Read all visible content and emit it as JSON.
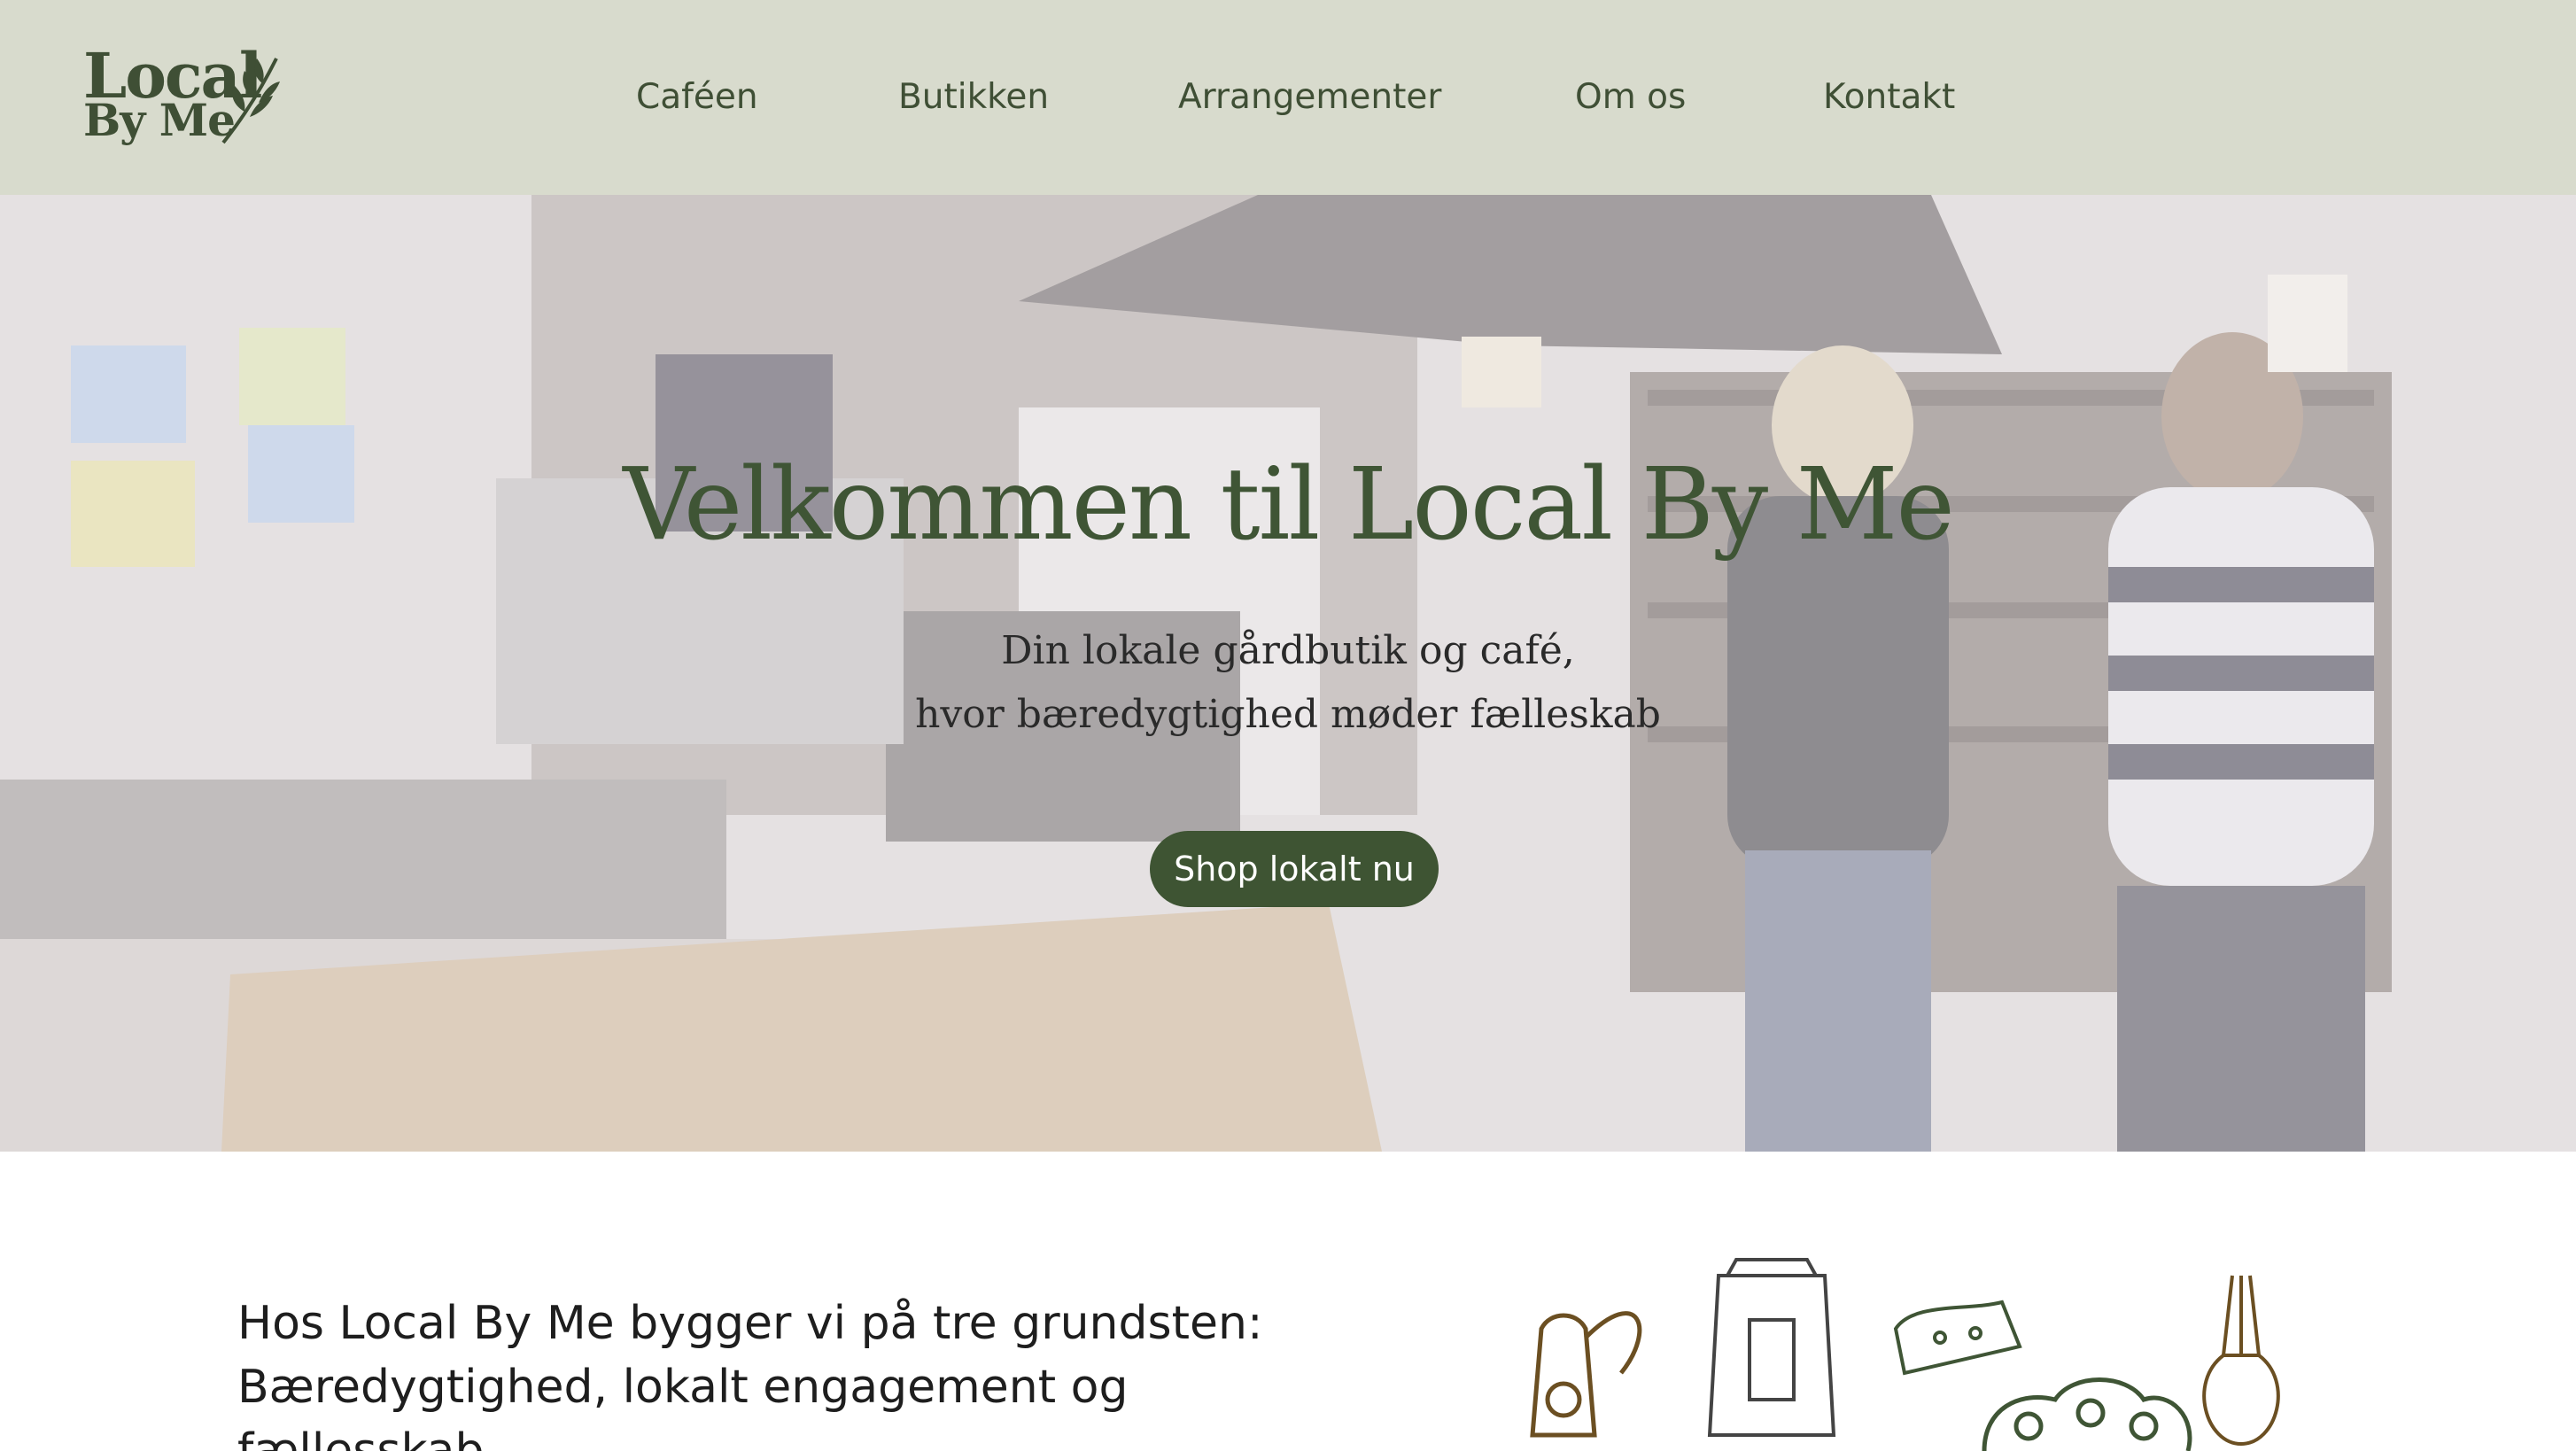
{
  "header": {
    "logo_line1": "Local",
    "logo_line2": "By Me",
    "nav": [
      "Caféen",
      "Butikken",
      "Arrangementer",
      "Om os",
      "Kontakt"
    ]
  },
  "hero": {
    "title": "Velkommen til Local By Me",
    "subtitle_line1": "Din lokale gårdbutik og café,",
    "subtitle_line2": "hvor bæredygtighed møder fælleskab",
    "cta": "Shop lokalt nu"
  },
  "intro": {
    "text": "Hos Local By Me bygger vi på tre grundsten: Bæredygtighed, lokalt engagement og fællesskab"
  },
  "colors": {
    "header_bg": "#d8dbcd",
    "brand_green": "#3e5433",
    "text_dark": "#1e1e1e"
  },
  "icons": [
    "wheat-icon",
    "milk-jug-icon",
    "coffee-bag-icon",
    "cheese-icon",
    "broccoli-icon",
    "onion-icon"
  ]
}
